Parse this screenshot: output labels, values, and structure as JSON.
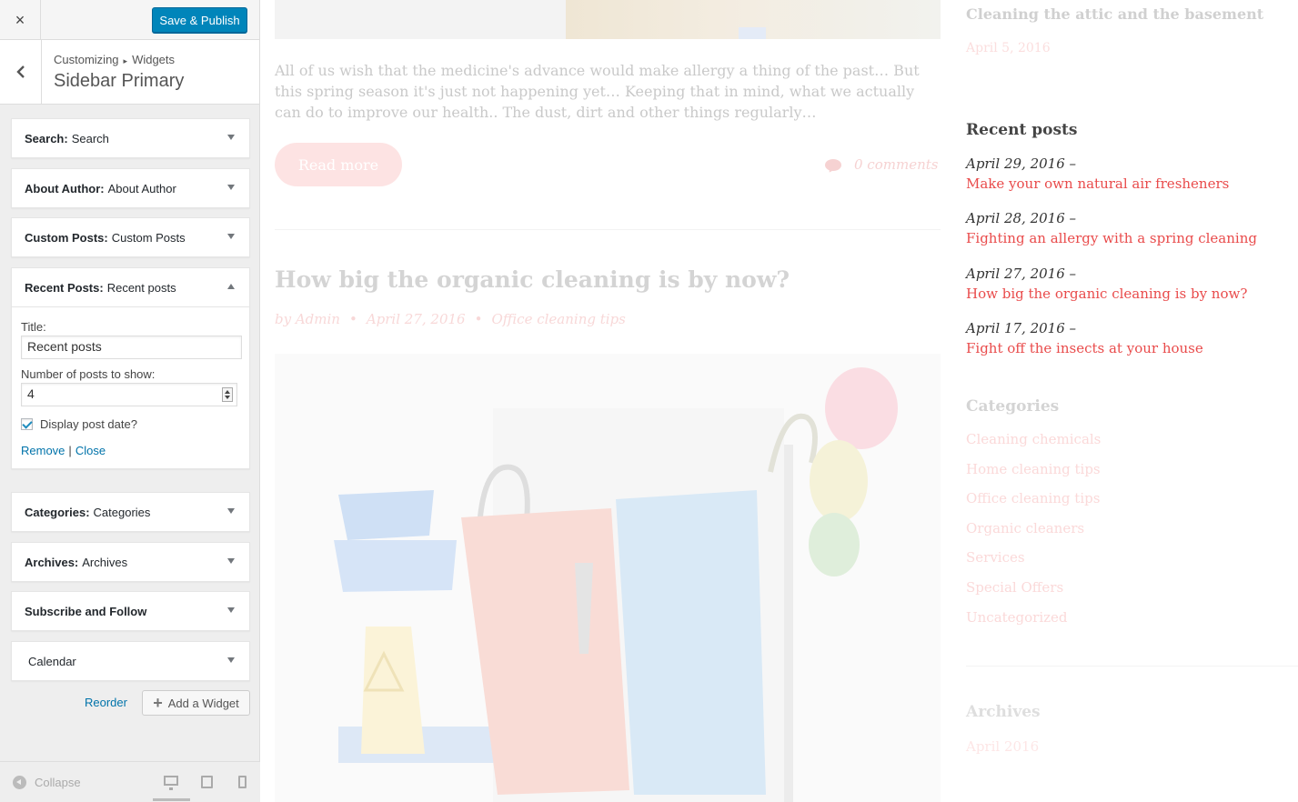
{
  "customizer": {
    "close_label": "×",
    "save_button": "Save & Publish",
    "breadcrumb": [
      "Customizing",
      "Widgets"
    ],
    "breadcrumb_sep": "▸",
    "panel_title": "Sidebar Primary",
    "widgets": [
      {
        "type": "Search:",
        "title": "Search"
      },
      {
        "type": "About Author:",
        "title": "About Author"
      },
      {
        "type": "Custom Posts:",
        "title": "Custom Posts"
      },
      {
        "type": "Recent Posts:",
        "title": "Recent posts"
      },
      {
        "type": "Categories:",
        "title": "Categories"
      },
      {
        "type": "Archives:",
        "title": "Archives"
      },
      {
        "type": "Subscribe and Follow",
        "title": ""
      },
      {
        "type": "",
        "title": "Calendar"
      }
    ],
    "recent_posts_form": {
      "title_label": "Title:",
      "title_value": "Recent posts",
      "count_label": "Number of posts to show:",
      "count_value": "4",
      "display_date_label": "Display post date?",
      "display_date_checked": true,
      "remove_link": "Remove",
      "close_link": "Close",
      "separator": "|"
    },
    "reorder_label": "Reorder",
    "add_widget_label": "Add a Widget",
    "collapse_label": "Collapse"
  },
  "preview": {
    "excerpt": "All of us wish that the medicine's advance would make allergy a thing of the past… But this spring season it's just not happening yet… Keeping that in mind, what we actually can do to improve our health.. The dust, dirt and other things regularly…",
    "read_more": "Read more",
    "comments": "0 comments",
    "post_title": "How big the organic cleaning is by now?",
    "post_author": "by Admin",
    "post_date": "April 27, 2016",
    "post_category": "Office cleaning tips",
    "meta_sep": "•",
    "sidebar": {
      "prev_title": "Cleaning the attic and the basement",
      "prev_date": "April 5, 2016",
      "recent_heading": "Recent posts",
      "recent_posts": [
        {
          "date": "April 29, 2016 –",
          "title": "Make your own natural air fresheners"
        },
        {
          "date": "April 28, 2016 –",
          "title": "Fighting an allergy with a spring cleaning"
        },
        {
          "date": "April 27, 2016 –",
          "title": "How big the organic cleaning is by now?"
        },
        {
          "date": "April 17, 2016 –",
          "title": "Fight off the insects at your house"
        }
      ],
      "categories_heading": "Categories",
      "categories": [
        "Cleaning chemicals",
        "Home cleaning tips",
        "Office cleaning tips",
        "Organic cleaners",
        "Services",
        "Special Offers",
        "Uncategorized"
      ],
      "archives_heading": "Archives",
      "archives": [
        "April 2016"
      ]
    }
  },
  "colors": {
    "primary_button": "#0085ba",
    "link": "#0073aa",
    "accent_red": "#e94b4b"
  }
}
